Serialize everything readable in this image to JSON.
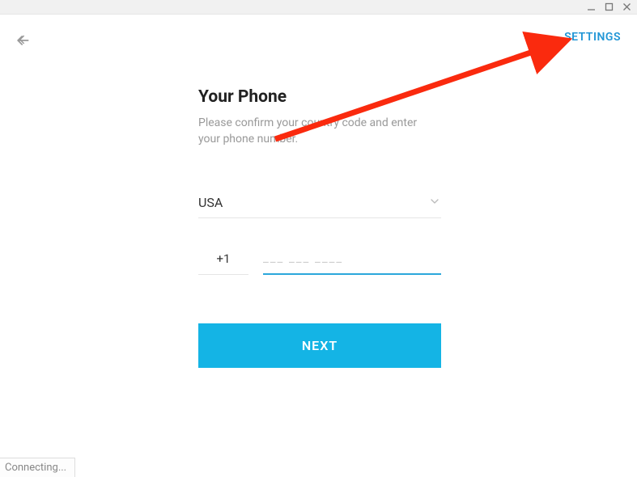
{
  "header": {
    "settings_label": "SETTINGS"
  },
  "form": {
    "title": "Your Phone",
    "subtitle": "Please confirm your country code and enter your phone number.",
    "country": "USA",
    "dial_code": "+1",
    "phone_placeholder": "___ ___ ____",
    "next_label": "NEXT"
  },
  "status": {
    "connecting": "Connecting..."
  },
  "colors": {
    "accent": "#14b4e5",
    "link": "#2196d6",
    "annotation": "#fa2a0e"
  }
}
